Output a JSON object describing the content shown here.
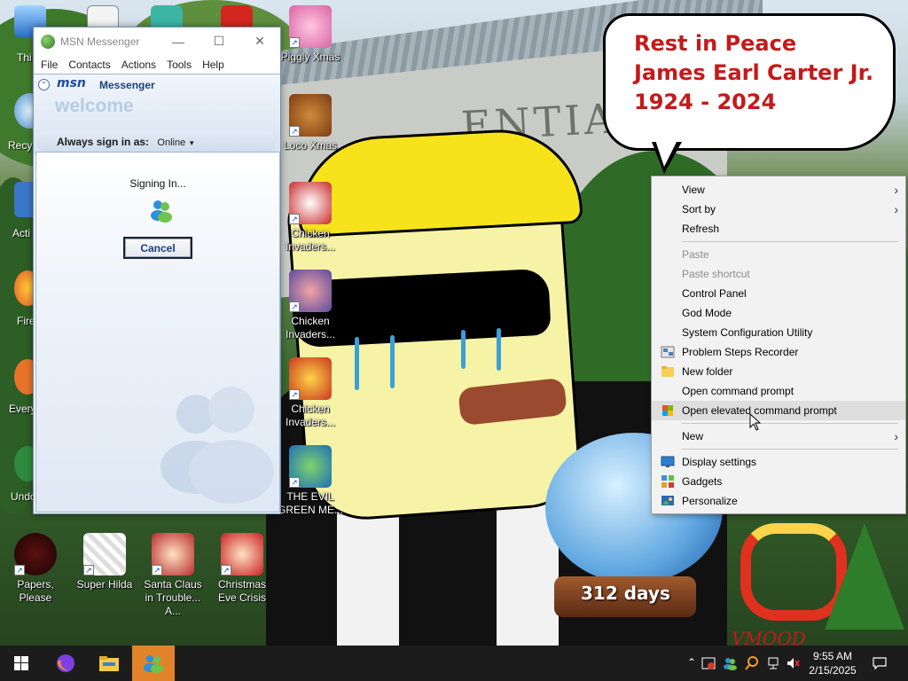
{
  "wallpaper": {
    "bubble_lines": [
      "Rest in Peace",
      "James Earl Carter Jr.",
      "1924 - 2024"
    ],
    "building_text": "ENTIAL",
    "globe_text": "312 days",
    "signature": "VMOOD"
  },
  "desktop_icons": [
    {
      "label": "Thi",
      "icon": "this-pc-icon"
    },
    {
      "label": "Recyc",
      "icon": "recycle-bin-icon"
    },
    {
      "label": "Acti",
      "icon": "activation-icon"
    },
    {
      "label": "Fire",
      "icon": "firefox-icon"
    },
    {
      "label": "Every",
      "icon": "everything-icon"
    },
    {
      "label": "Undo",
      "icon": "undo-icon"
    },
    {
      "label": "Piggly Xmas",
      "icon": "pig-icon"
    },
    {
      "label": "Loco Xmas",
      "icon": "bear-icon"
    },
    {
      "label": "Chicken Invaders...",
      "icon": "chicken-icon"
    },
    {
      "label": "Chicken Invaders...",
      "icon": "chicken-icon"
    },
    {
      "label": "Chicken Invaders...",
      "icon": "chicken-icon"
    },
    {
      "label": "THE EVIL GREEN ME...",
      "icon": "msn-buddy-icon"
    },
    {
      "label": "Papers, Please",
      "icon": "papers-please-icon"
    },
    {
      "label": "Super Hilda",
      "icon": "super-hilda-icon"
    },
    {
      "label": "Santa Claus in Trouble... A...",
      "icon": "santa-icon"
    },
    {
      "label": "Christmas Eve Crisis",
      "icon": "santa-icon"
    }
  ],
  "msn": {
    "window_title": "MSN Messenger",
    "menu": [
      "File",
      "Contacts",
      "Actions",
      "Tools",
      "Help"
    ],
    "logo": "msn",
    "logo_word": "Messenger",
    "welcome": "welcome",
    "always_sign_in_label": "Always sign in as:",
    "status": "Online",
    "signing_in": "Signing In...",
    "cancel": "Cancel"
  },
  "context_menu": {
    "items": [
      {
        "label": "View",
        "submenu": true
      },
      {
        "label": "Sort by",
        "submenu": true
      },
      {
        "label": "Refresh"
      },
      {
        "label": "Paste",
        "disabled": true
      },
      {
        "label": "Paste shortcut",
        "disabled": true
      },
      {
        "label": "Control Panel"
      },
      {
        "label": "God Mode"
      },
      {
        "label": "System Configuration Utility"
      },
      {
        "label": "Problem Steps Recorder",
        "icon": "steps-recorder-icon"
      },
      {
        "label": "New folder",
        "icon": "folder-icon"
      },
      {
        "label": "Open command prompt"
      },
      {
        "label": "Open elevated command prompt",
        "icon": "uac-shield-icon",
        "highlighted": true
      },
      {
        "label": "New",
        "submenu": true
      },
      {
        "label": "Display settings",
        "icon": "display-icon"
      },
      {
        "label": "Gadgets",
        "icon": "gadgets-icon"
      },
      {
        "label": "Personalize",
        "icon": "personalize-icon"
      }
    ]
  },
  "taskbar": {
    "time": "9:55 AM",
    "date": "2/15/2025"
  }
}
